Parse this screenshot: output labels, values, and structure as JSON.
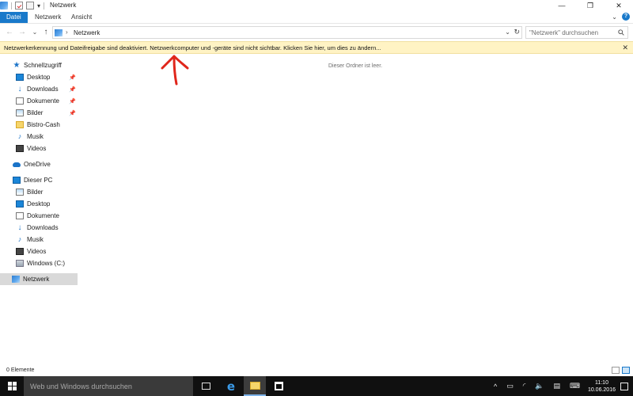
{
  "window": {
    "title": "Netzwerk",
    "controls": {
      "minimize": "—",
      "maximize": "❐",
      "close": "✕"
    }
  },
  "ribbon": {
    "tabs": [
      "Datei",
      "Netzwerk",
      "Ansicht"
    ]
  },
  "address": {
    "path": "Netzwerk",
    "search_placeholder": "\"Netzwerk\" durchsuchen"
  },
  "infobar": {
    "message": "Netzwerkerkennung und Dateifreigabe sind deaktiviert. Netzwerkcomputer und -geräte sind nicht sichtbar. Klicken Sie hier, um dies zu ändern...",
    "close": "✕"
  },
  "sidebar": {
    "quick_access": {
      "label": "Schnellzugriff",
      "items": [
        "Desktop",
        "Downloads",
        "Dokumente",
        "Bilder",
        "Bistro-Cash",
        "Musik",
        "Videos"
      ]
    },
    "onedrive": "OneDrive",
    "this_pc": {
      "label": "Dieser PC",
      "items": [
        "Bilder",
        "Desktop",
        "Dokumente",
        "Downloads",
        "Musik",
        "Videos",
        "Windows (C:)"
      ]
    },
    "network": "Netzwerk"
  },
  "content": {
    "empty_message": "Dieser Ordner ist leer."
  },
  "status": {
    "count": "0 Elemente"
  },
  "taskbar": {
    "search_placeholder": "Web und Windows durchsuchen",
    "time": "11:10",
    "date": "10.06.2016"
  },
  "colors": {
    "accent": "#1979ca",
    "infobar": "#fff3c4",
    "annotation_arrow": "#e0261b",
    "taskbar": "#101010"
  },
  "icons": {
    "quick_access": "star-icon",
    "desktop": "desktop-icon",
    "downloads": "download-arrow-icon",
    "documents": "document-icon",
    "pictures": "pictures-icon",
    "folder": "folder-icon",
    "music": "music-note-icon",
    "videos": "video-icon",
    "onedrive": "cloud-icon",
    "this_pc": "computer-icon",
    "drive": "drive-icon",
    "network": "network-icon"
  }
}
